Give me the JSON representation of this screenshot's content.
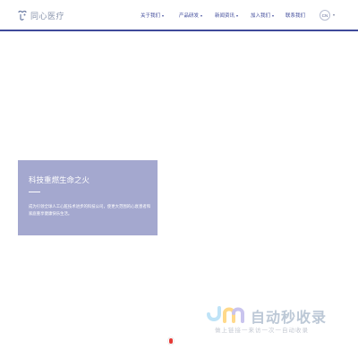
{
  "header": {
    "logo_text": "同心医疗",
    "nav": [
      {
        "label": "关于我们",
        "has_dropdown": true
      },
      {
        "label": "产品研发",
        "has_dropdown": true
      },
      {
        "label": "新闻资讯",
        "has_dropdown": true
      },
      {
        "label": "加入我们",
        "has_dropdown": true
      },
      {
        "label": "联系我们",
        "has_dropdown": false
      }
    ],
    "lang": "CN"
  },
  "hero": {
    "title": "科技重燃生命之火",
    "description": "成为引领全球人工心脏技术进步的科技公司，使更大范围的心衰患者和家庭重享健康快乐生活。"
  },
  "watermark": {
    "title": "自动秒收录",
    "subtitle": "做上链接一来访一次一自动收录"
  },
  "colors": {
    "brand": "#3f4a9a",
    "card": "#a4a8cf",
    "indicator": "#e53935"
  }
}
